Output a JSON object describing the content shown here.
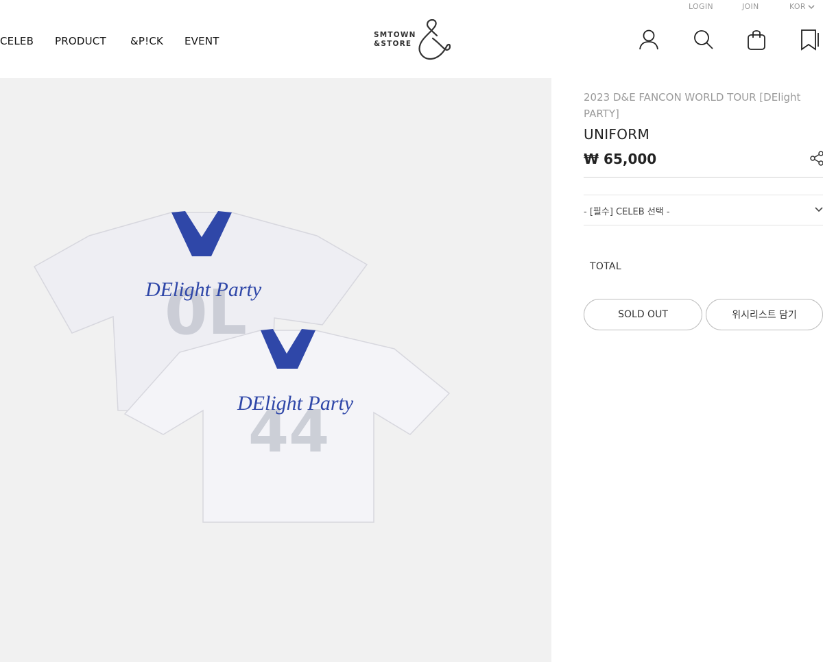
{
  "utility": {
    "login": "LOGIN",
    "join": "JOIN",
    "language": "KOR"
  },
  "nav": {
    "items": [
      "CELEB",
      "PRODUCT",
      "&P!CK",
      "EVENT"
    ]
  },
  "logo": {
    "line1": "SMTOWN",
    "line2": "&STORE"
  },
  "header_icons": [
    "user-icon",
    "search-icon",
    "bag-icon",
    "bookmark-icon"
  ],
  "product": {
    "subtitle": "2023 D&E FANCON WORLD TOUR [DElight PARTY]",
    "title": "UNIFORM",
    "price": "₩ 65,000",
    "jersey_text": "DElight Party",
    "option_placeholder": "- [필수] CELEB 선택 -",
    "total_label": "TOTAL",
    "sold_out_label": "SOLD OUT",
    "wishlist_label": "위시리스트 담기"
  },
  "colors": {
    "accent_blue": "#2f47a8",
    "hero_bg": "#f1f1f1",
    "muted_text": "#9a9a9a"
  }
}
